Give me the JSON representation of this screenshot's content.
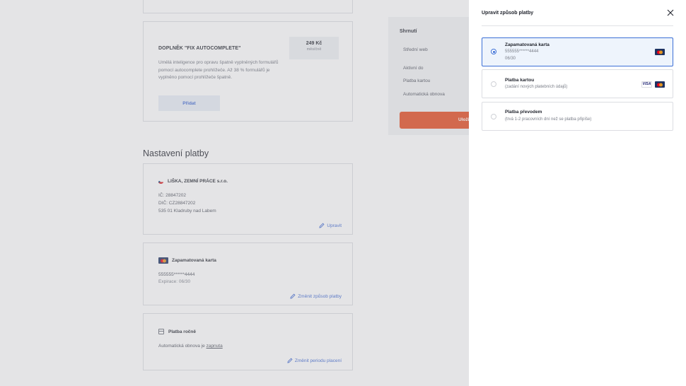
{
  "addon": {
    "title": "DOPLNĚK \"FIX AUTOCOMPLETE\"",
    "description": "Umělá inteligence pro opravu špatně vyplněných formulářů pomocí autocomplete prohlížeče. Až 38 % formulářů je vyplněno pomocí prohlížeče špatně.",
    "price": "249 Kč",
    "price_unit": "měsíčně",
    "add_label": "Přidat"
  },
  "summary": {
    "title": "Shrnutí",
    "rows": [
      "Střední web",
      "Aktivní do",
      "Platba kartou",
      "Automatická obnova"
    ],
    "save_label": "Uloži"
  },
  "payment_settings": {
    "title": "Nastavení platby",
    "company": {
      "name": "LIŠKA, ZEMNÍ PRÁCE s.r.o.",
      "ic": "IČ: 28847202",
      "dic": "DIČ: CZ28847202",
      "address": "535 01 Kladruby nad Labem",
      "edit_label": "Upravit"
    },
    "card": {
      "label": "Zapamatovaná karta",
      "number": "555555******4444",
      "expiry": "Expirace: 06/30",
      "change_label": "Změnit způsob platby"
    },
    "billing": {
      "label": "Platba ročně",
      "text_prefix": "Automatická obnova je ",
      "status": "zapnuta",
      "change_label": "Změnit periodu placení"
    }
  },
  "modal": {
    "title": "Upravit způsob platby",
    "options": [
      {
        "title": "Zapamatovaná karta",
        "line1": "555555******4444",
        "line2": "06/30",
        "selected": true
      },
      {
        "title": "Platba kartou",
        "line1": "(zadání nových platebních údajů)",
        "selected": false
      },
      {
        "title": "Platba převodem",
        "line1": "(trvá 1-2 pracovních dní než se platba připíše)",
        "selected": false
      }
    ],
    "visa_text": "VISA"
  },
  "icons": {
    "close": "close-icon",
    "edit": "pencil-icon",
    "card_brand": "mastercard-icon",
    "visa": "visa-icon",
    "calendar": "calendar-icon",
    "flag": "czech-flag-icon"
  },
  "colors": {
    "accent": "#3b66d1",
    "primary_button": "#e54b1f",
    "selected_border": "#3b6fd6"
  }
}
